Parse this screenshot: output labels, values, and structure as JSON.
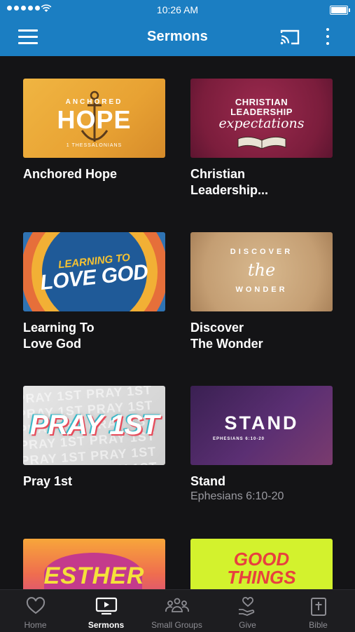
{
  "status_bar": {
    "time": "10:26 AM"
  },
  "app_bar": {
    "title": "Sermons"
  },
  "sermons": [
    {
      "title_line1": "Anchored Hope",
      "title_line2": "",
      "subtitle": "",
      "thumb": {
        "small": "ANCHORED",
        "big": "HOPE",
        "ref": "1 THESSALONIANS"
      }
    },
    {
      "title_line1": "Christian",
      "title_line2": "Leadership...",
      "subtitle": "",
      "thumb": {
        "l1": "CHRISTIAN",
        "l2": "LEADERSHIP",
        "l3": "expectations"
      }
    },
    {
      "title_line1": "Learning To",
      "title_line2": "Love God",
      "subtitle": "",
      "thumb": {
        "line1": "LEARNING TO",
        "line2": "LOVE GOD"
      }
    },
    {
      "title_line1": "Discover",
      "title_line2": "The Wonder",
      "subtitle": "",
      "thumb": {
        "top": "DISCOVER",
        "mid": "the",
        "bot": "WONDER"
      }
    },
    {
      "title_line1": "Pray 1st",
      "title_line2": "",
      "subtitle": "",
      "thumb": {
        "main": "PRAY 1ST",
        "bg": "PRAY 1ST PRAY 1ST PRAY 1ST PRAY 1ST PRAY 1ST PRAY 1ST PRAY 1ST PRAY 1ST PRAY 1ST PRAY 1ST PRAY 1ST PRAY 1ST"
      }
    },
    {
      "title_line1": "Stand",
      "title_line2": "",
      "subtitle": "Ephesians 6:10-20",
      "thumb": {
        "main": "STAND",
        "ref": "EPHESIANS 6:10-20"
      }
    },
    {
      "title_line1": "",
      "title_line2": "",
      "subtitle": "",
      "thumb": {
        "main": "ESTHER"
      }
    },
    {
      "title_line1": "",
      "title_line2": "",
      "subtitle": "",
      "thumb": {
        "l1": "GOOD",
        "l2": "THINGS"
      }
    }
  ],
  "tab_bar": [
    {
      "label": "Home",
      "icon": "heart-icon"
    },
    {
      "label": "Sermons",
      "icon": "tv-play-icon"
    },
    {
      "label": "Small Groups",
      "icon": "people-icon"
    },
    {
      "label": "Give",
      "icon": "hand-heart-icon"
    },
    {
      "label": "Bible",
      "icon": "bible-icon"
    }
  ],
  "colors": {
    "app_bar": "#1b7ec2",
    "background": "#141416",
    "tab_bar": "#1d1d20",
    "inactive_tab": "#8d8d93"
  }
}
